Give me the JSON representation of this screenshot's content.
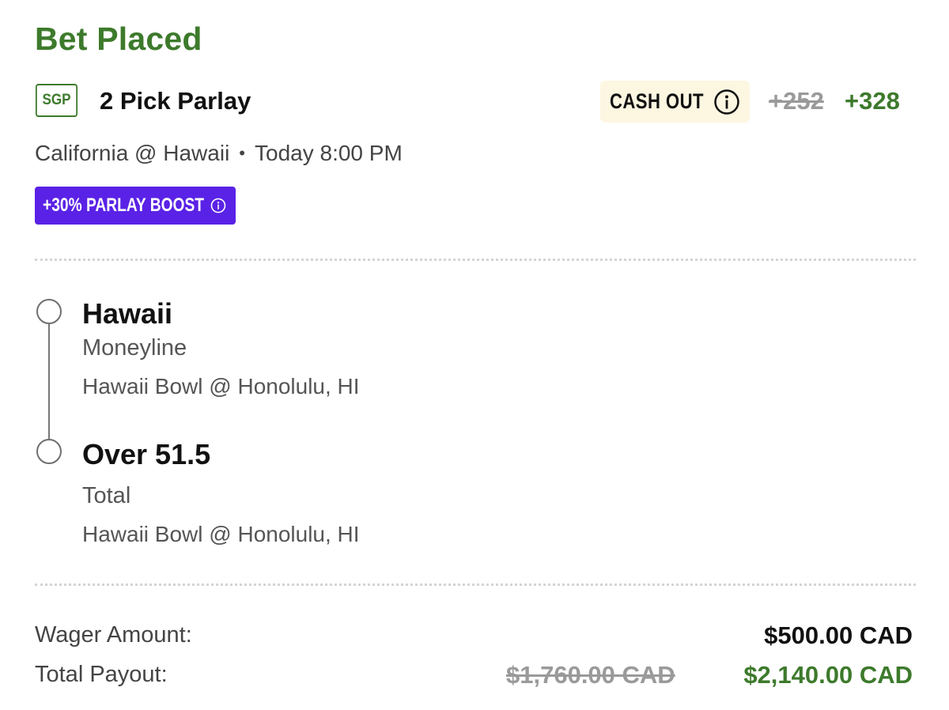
{
  "header": {
    "title": "Bet Placed",
    "badge": "SGP",
    "bet_type": "2 Pick Parlay",
    "cash_out_label": "CASH OUT",
    "odds_original": "+252",
    "odds_boosted": "+328",
    "matchup": "California @ Hawaii",
    "separator": "•",
    "time": "Today 8:00 PM",
    "boost_label": "+30% PARLAY BOOST"
  },
  "legs": [
    {
      "selection": "Hawaii",
      "market": "Moneyline",
      "event": "Hawaii Bowl @ Honolulu, HI"
    },
    {
      "selection": "Over 51.5",
      "market": "Total",
      "event": "Hawaii Bowl @ Honolulu, HI"
    }
  ],
  "summary": {
    "wager_label": "Wager Amount:",
    "wager_value": "$500.00 CAD",
    "payout_label": "Total Payout:",
    "payout_original": "$1,760.00 CAD",
    "payout_boosted": "$2,140.00 CAD"
  },
  "colors": {
    "brand_green": "#3d7a2c",
    "boost_purple": "#5a22e6",
    "cashout_bg": "#fdf6e1",
    "muted_gray": "#9a9a9a"
  },
  "icons": {
    "cash_out_info": "info-circle-icon",
    "boost_info": "info-circle-icon",
    "leg_marker": "empty-circle-icon"
  }
}
